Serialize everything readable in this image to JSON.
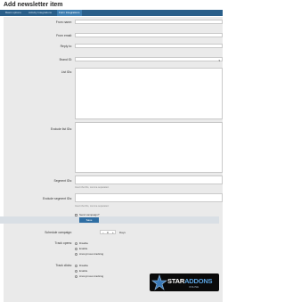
{
  "page": {
    "title": "Add newsletter item"
  },
  "tabs": [
    {
      "label": "Basic options",
      "active": false
    },
    {
      "label": "Activity Integrations",
      "active": false
    },
    {
      "label": "Form Integrations",
      "active": true
    }
  ],
  "form": {
    "from_name_label": "From name:",
    "from_email_label": "From email:",
    "reply_to_label": "Reply to:",
    "brand_id_label": "Brand ID:",
    "list_ids_label": "List IDs:",
    "exclude_list_ids_label": "Exclude list IDs:",
    "segment_ids_label": "Segment IDs:",
    "segment_ids_help": "Insert the IDs, comma separated.",
    "exclude_segment_ids_label": "Exclude segment IDs:",
    "exclude_segment_ids_help": "Insert the IDs, comma separated.",
    "send_campaign_label": "Send campaign?",
    "save_label": "Save",
    "schedule_label": "Schedule campaign:",
    "schedule_value": "0",
    "schedule_unit": "Days",
    "track_opens_label": "Track opens:",
    "track_opens_options": [
      "Disable",
      "Enable",
      "Anonymous tracking"
    ],
    "track_clicks_label": "Track clicks:",
    "track_clicks_options": [
      "Disable",
      "Enable",
      "Anonymous tracking"
    ]
  },
  "brand": {
    "logo_text_a": "STAR",
    "logo_text_b": "ADDONS",
    "logo_sub": "ONLINE"
  },
  "colors": {
    "tabbar": "#2a5f8a",
    "accent": "#2f6ea3",
    "form_bg": "#eaeaea"
  }
}
